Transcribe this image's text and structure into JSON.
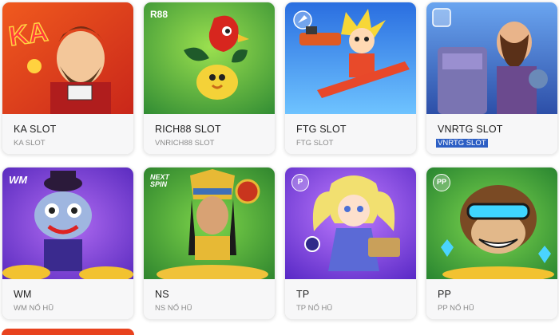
{
  "games": [
    {
      "title": "KA SLOT",
      "provider": "KA SLOT",
      "badge": "",
      "colors": [
        "#e8421e",
        "#f28a1a"
      ]
    },
    {
      "title": "RICH88 SLOT",
      "provider": "VNRICH88 SLOT",
      "badge": "R88",
      "colors": [
        "#2d8f3a",
        "#8fd34a"
      ]
    },
    {
      "title": "FTG SLOT",
      "provider": "FTG SLOT",
      "badge": "",
      "colors": [
        "#1f5fd6",
        "#5ab3ff"
      ]
    },
    {
      "title": "VNRTG SLOT",
      "provider": "VNRTG SLOT",
      "badge": "",
      "colors": [
        "#3a6fd1",
        "#9ec6f5"
      ]
    },
    {
      "title": "WM",
      "provider": "WM NỔ HŨ",
      "badge": "WM",
      "colors": [
        "#5b2bc9",
        "#a855f7"
      ]
    },
    {
      "title": "NS",
      "provider": "NS NỔ HŨ",
      "badge": "NEXT SPIN",
      "colors": [
        "#2a8c2f",
        "#7fcf3a"
      ]
    },
    {
      "title": "TP",
      "provider": "TP NỔ HŨ",
      "badge": "P",
      "colors": [
        "#6a2bd6",
        "#b36bff"
      ]
    },
    {
      "title": "PP",
      "provider": "PP NỔ HŨ",
      "badge": "PP",
      "colors": [
        "#1f8a2e",
        "#6fd14a"
      ]
    }
  ],
  "icons": [
    "ka-art",
    "rich88-art",
    "ftg-art",
    "vnrtg-art",
    "wm-art",
    "ns-art",
    "tp-art",
    "pp-art"
  ]
}
